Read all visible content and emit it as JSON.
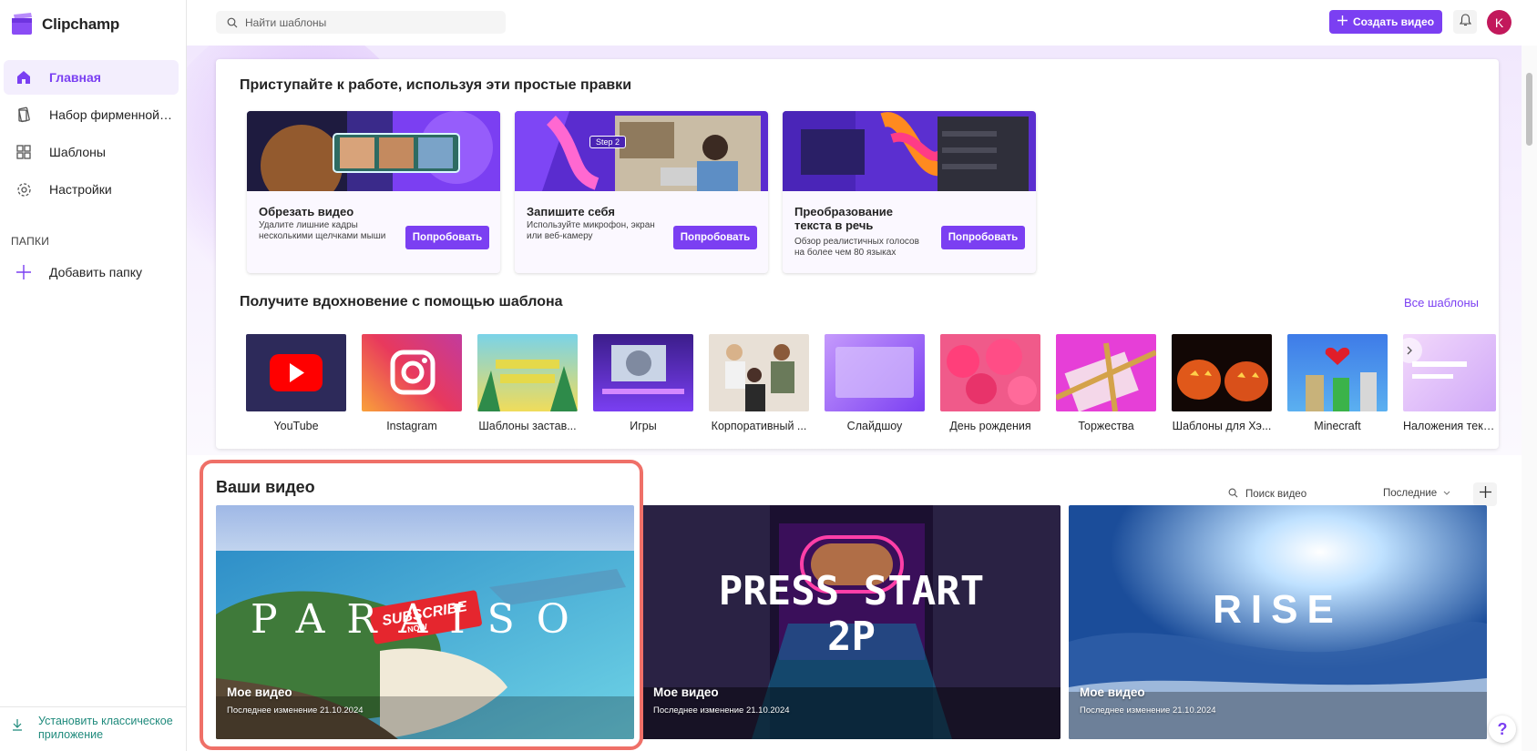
{
  "app": {
    "name": "Clipchamp"
  },
  "sidebar": {
    "items": [
      {
        "label": "Главная",
        "icon": "home-icon"
      },
      {
        "label": "Набор фирменной си...",
        "icon": "brand-kit-icon"
      },
      {
        "label": "Шаблоны",
        "icon": "templates-icon"
      },
      {
        "label": "Настройки",
        "icon": "gear-icon"
      }
    ],
    "folders_label": "ПАПКИ",
    "add_folder": "Добавить папку",
    "install_app": "Установить классическое приложение"
  },
  "topbar": {
    "search_placeholder": "Найти шаблоны",
    "create_label": "Создать видео",
    "avatar_letter": "K"
  },
  "quick_edits": {
    "title": "Приступайте к работе, используя эти простые правки",
    "cards": [
      {
        "title": "Обрезать видео",
        "description": "Удалите лишние кадры несколькими щелчками мыши",
        "button": "Попробовать"
      },
      {
        "title": "Запишите себя",
        "description": "Используйте микрофон, экран или веб-камеру",
        "button": "Попробовать",
        "badge": "Step 2"
      },
      {
        "title": "Преобразование текста в речь",
        "description": "Обзор реалистичных голосов на более чем 80 языках",
        "button": "Попробовать"
      }
    ]
  },
  "templates": {
    "title": "Получите вдохновение с помощью шаблона",
    "all_link": "Все шаблоны",
    "items": [
      {
        "label": "YouTube"
      },
      {
        "label": "Instagram"
      },
      {
        "label": "Шаблоны застав..."
      },
      {
        "label": "Игры"
      },
      {
        "label": "Корпоративный ..."
      },
      {
        "label": "Слайдшоу"
      },
      {
        "label": "День рождения"
      },
      {
        "label": "Торжества"
      },
      {
        "label": "Шаблоны для Хэ..."
      },
      {
        "label": "Minecraft"
      },
      {
        "label": "Наложения текс..."
      }
    ]
  },
  "your_videos": {
    "title": "Ваши видео",
    "search_placeholder": "Поиск видео",
    "sort": "Последние",
    "videos": [
      {
        "thumb_text": "PARAISO",
        "badge": "SUBSCRIBE",
        "badge_sub": "NOW",
        "title": "Мое видео",
        "subtitle": "Последнее изменение 21.10.2024"
      },
      {
        "thumb_text": "PRESS START 2P",
        "title": "Мое видео",
        "subtitle": "Последнее изменение 21.10.2024"
      },
      {
        "thumb_text": "RISE",
        "title": "Мое видео",
        "subtitle": "Последнее изменение 21.10.2024"
      }
    ]
  },
  "colors": {
    "accent": "#7b3ff2",
    "highlight": "#ef7068",
    "avatar": "#c2185b"
  }
}
